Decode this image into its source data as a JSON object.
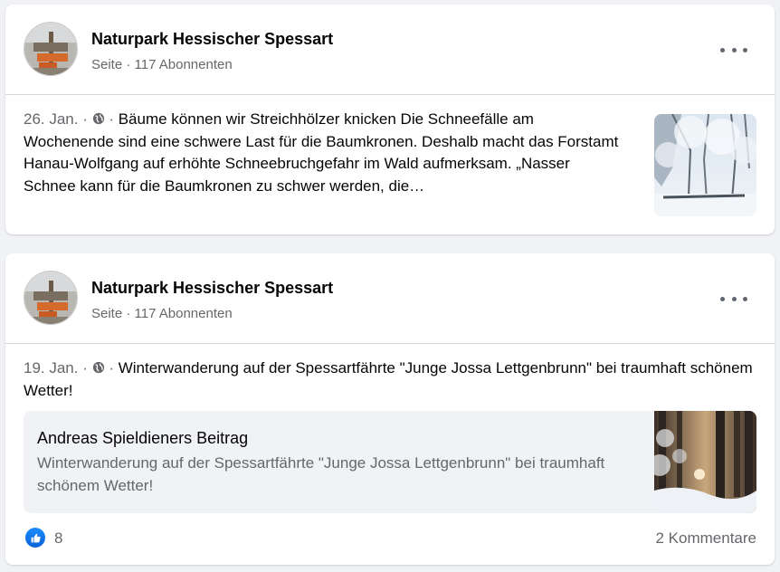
{
  "colors": {
    "accent": "#1877f2",
    "muted": "#65676b",
    "background": "#f0f2f5"
  },
  "posts": [
    {
      "page_name": "Naturpark Hessischer Spessart",
      "page_meta": "Seite · 117 Abonnenten",
      "date": "26. Jan.",
      "sep1": " · ",
      "sep2": " · ",
      "privacy_icon": "globe-icon",
      "text": "Bäume können wir Streichhölzer knicken Die Schneefälle am Wochenende sind eine schwere Last für die Baumkronen. Deshalb macht das Forstamt Hanau-Wolfgang auf erhöhte Schneebruchgefahr im Wald aufmerksam. „Nasser Schnee kann für die Baumkronen zu schwer werden, die…"
    },
    {
      "page_name": "Naturpark Hessischer Spessart",
      "page_meta": "Seite · 117 Abonnenten",
      "date": "19. Jan.",
      "sep1": " · ",
      "sep2": " · ",
      "privacy_icon": "globe-icon",
      "text": "Winterwanderung auf der Spessartfährte \"Junge Jossa Lettgenbrunn\" bei traumhaft schönem Wetter!",
      "shared": {
        "title": "Andreas Spieldieners Beitrag",
        "description": "Winterwanderung auf der Spessartfährte \"Junge Jossa Lettgenbrunn\" bei traumhaft schönem Wetter!"
      },
      "reactions": {
        "icon": "like-icon",
        "count": "8"
      },
      "comments": "2 Kommentare"
    }
  ]
}
